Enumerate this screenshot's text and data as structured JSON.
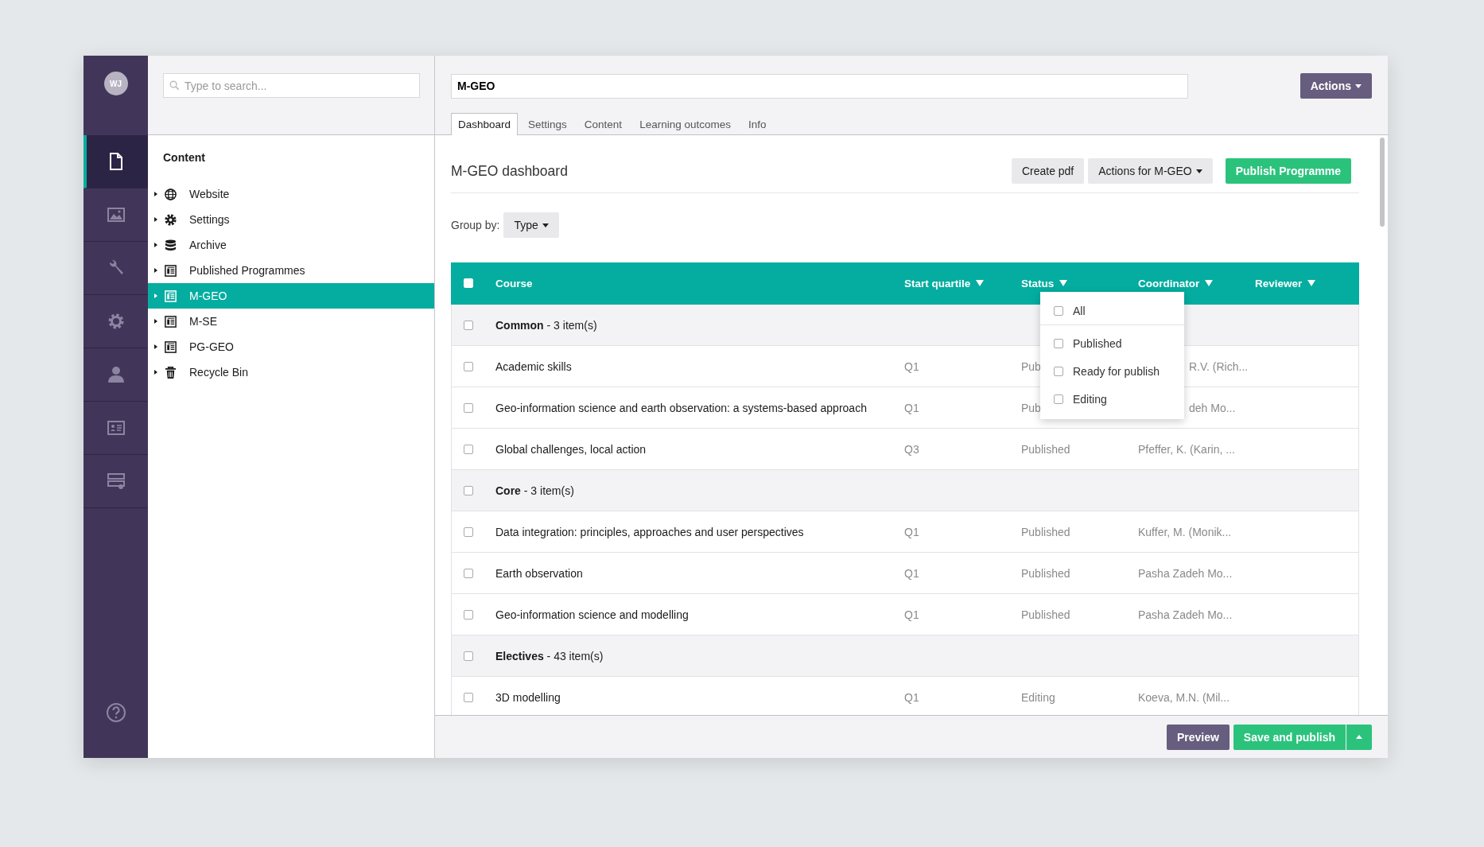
{
  "user": {
    "initials": "WJ"
  },
  "rail": [
    {
      "kind": "content",
      "selected": true
    },
    {
      "kind": "media",
      "selected": false
    },
    {
      "kind": "tools",
      "selected": false
    },
    {
      "kind": "settings",
      "selected": false
    },
    {
      "kind": "users",
      "selected": false
    },
    {
      "kind": "members",
      "selected": false
    },
    {
      "kind": "forms",
      "selected": false
    }
  ],
  "search": {
    "placeholder": "Type to search..."
  },
  "tree": {
    "title": "Content",
    "items": [
      {
        "label": "Website",
        "kind": "website",
        "selected": false,
        "expanded": false
      },
      {
        "label": "Settings",
        "kind": "settings",
        "selected": false,
        "expanded": false
      },
      {
        "label": "Archive",
        "kind": "archive",
        "selected": false,
        "expanded": false
      },
      {
        "label": "Published Programmes",
        "kind": "programme",
        "selected": false,
        "expanded": false
      },
      {
        "label": "M-GEO",
        "kind": "programme",
        "selected": true,
        "expanded": false
      },
      {
        "label": "M-SE",
        "kind": "programme",
        "selected": false,
        "expanded": false
      },
      {
        "label": "PG-GEO",
        "kind": "programme",
        "selected": false,
        "expanded": false
      },
      {
        "label": "Recycle Bin",
        "kind": "bin",
        "selected": false,
        "expanded": false
      }
    ]
  },
  "document": {
    "name": "M-GEO",
    "actions": "Actions",
    "tabs": [
      {
        "label": "Dashboard",
        "selected": true
      },
      {
        "label": "Settings",
        "selected": false
      },
      {
        "label": "Content",
        "selected": false
      },
      {
        "label": "Learning outcomes",
        "selected": false
      },
      {
        "label": "Info",
        "selected": false
      }
    ]
  },
  "dashboard": {
    "title": "M-GEO dashboard",
    "buttons": [
      {
        "label": "Create pdf",
        "kind": "default",
        "dropdown": false
      },
      {
        "label": "Actions for M-GEO",
        "kind": "default",
        "dropdown": true
      },
      {
        "label": "Publish Programme",
        "kind": "success",
        "dropdown": false
      }
    ],
    "group_by": {
      "label": "Group by:",
      "value": "Type"
    }
  },
  "table": {
    "select_all": {
      "checked": false
    },
    "columns": [
      {
        "label": "Course",
        "filter": false
      },
      {
        "label": "Start quartile",
        "filter": true
      },
      {
        "label": "Status",
        "filter": true
      },
      {
        "label": "Coordinator",
        "filter": true
      },
      {
        "label": "Reviewer",
        "filter": true
      }
    ],
    "groups": [
      {
        "title": "**Common** - 3 item(s)",
        "checked": false,
        "rows": [
          {
            "course": "Academic skills",
            "quartile": "Q1",
            "status": "Pub",
            "coordinator": "R.V. (Rich...",
            "covered": true,
            "checked": false
          },
          {
            "course": "Geo-information science and earth observation: a systems-based approach",
            "quartile": "Q1",
            "status": "Pub",
            "coordinator": "deh Mo...",
            "covered": true,
            "checked": false
          },
          {
            "course": "Global challenges, local action",
            "quartile": "Q3",
            "status": "Published",
            "coordinator": "Pfeffer, K. (Karin, ...",
            "covered": false,
            "checked": false
          }
        ]
      },
      {
        "title": "**Core** - 3 item(s)",
        "checked": false,
        "rows": [
          {
            "course": "Data integration: principles, approaches and user perspectives",
            "quartile": "Q1",
            "status": "Published",
            "coordinator": "Kuffer, M. (Monik...",
            "covered": false,
            "checked": false
          },
          {
            "course": "Earth observation",
            "quartile": "Q1",
            "status": "Published",
            "coordinator": "Pasha Zadeh Mo...",
            "covered": false,
            "checked": false
          },
          {
            "course": "Geo-information science and modelling",
            "quartile": "Q1",
            "status": "Published",
            "coordinator": "Pasha Zadeh Mo...",
            "covered": false,
            "checked": false
          }
        ]
      },
      {
        "title": "**Electives** - 43 item(s)",
        "checked": false,
        "rows": [
          {
            "course": "3D modelling",
            "quartile": "Q1",
            "status": "Editing",
            "coordinator": "Koeva, M.N. (Mil...",
            "covered": false,
            "checked": false
          }
        ]
      }
    ]
  },
  "status_filter": {
    "options": [
      {
        "label": "All",
        "checked": false
      },
      {
        "label": "Published",
        "checked": false
      },
      {
        "label": "Ready for publish",
        "checked": false
      },
      {
        "label": "Editing",
        "checked": false
      }
    ]
  },
  "footer": {
    "buttons": [
      {
        "label": "Preview",
        "kind": "primary",
        "split": false
      },
      {
        "label": "Save and publish",
        "kind": "success",
        "split": true
      }
    ]
  }
}
